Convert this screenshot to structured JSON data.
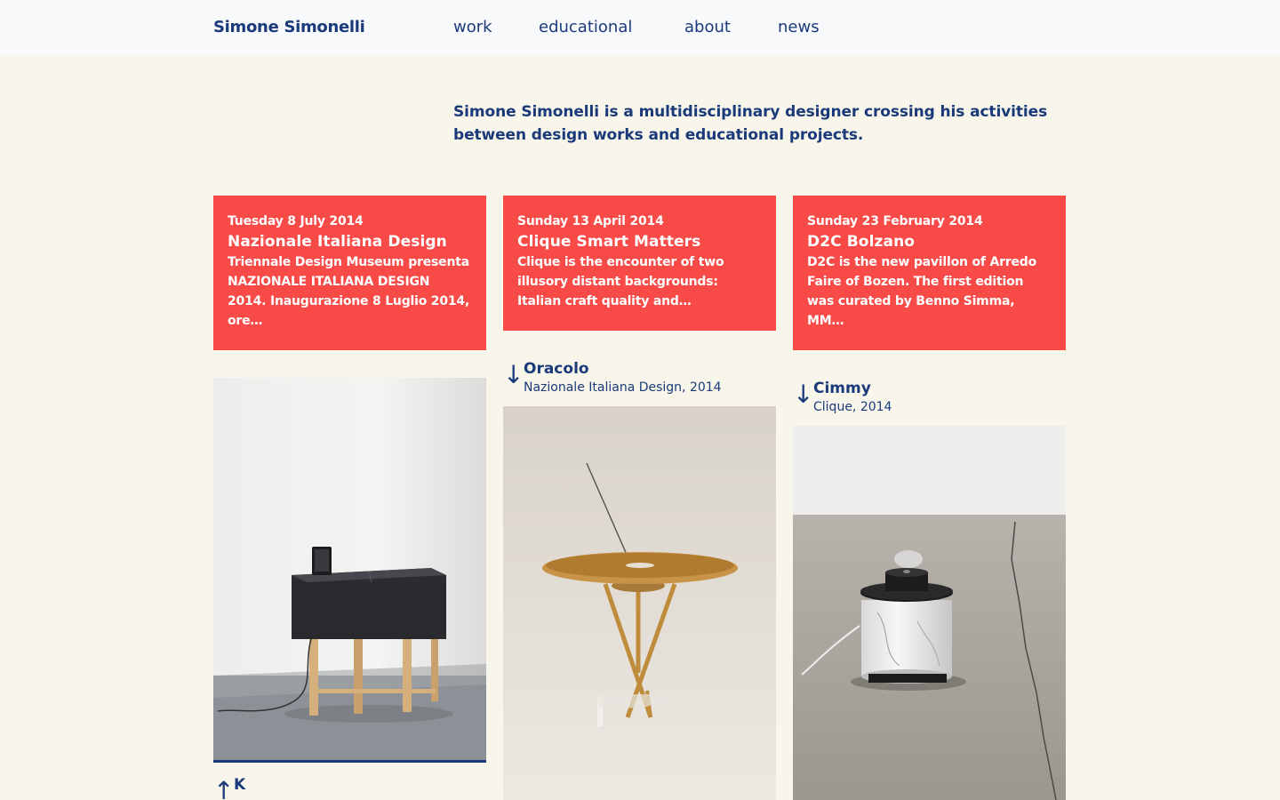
{
  "header": {
    "brand": "Simone Simonelli",
    "nav": [
      {
        "label": "work"
      },
      {
        "label": "educational"
      },
      {
        "label": "about"
      },
      {
        "label": "news"
      }
    ]
  },
  "intro": "Simone Simonelli is a multidisciplinary designer crossing his activities between design works and educational projects.",
  "news": [
    {
      "date": "Tuesday 8 July 2014",
      "title": "Nazionale Italiana Design",
      "excerpt": "Triennale Design Museum presenta NAZIONALE ITALIANA DESIGN 2014. Inaugurazione 8 Luglio 2014, ore…"
    },
    {
      "date": "Sunday 13 April 2014",
      "title": "Clique Smart Matters",
      "excerpt": "Clique is the encounter of two illusory distant backgrounds: Italian craft quality and…"
    },
    {
      "date": "Sunday 23 February 2014",
      "title": "D2C Bolzano",
      "excerpt": "D2C is the new pavillon of Arredo Faire of Bozen. The first edition was curated by Benno Simma, MM…"
    }
  ],
  "works": [
    {
      "name": "K",
      "arrow": "↑",
      "image": "desk-cabinet-photo"
    },
    {
      "name": "Oracolo",
      "subtitle": "Nazionale Italiana Design, 2014",
      "arrow": "↓",
      "image": "round-table-photo"
    },
    {
      "name": "Cimmy",
      "subtitle": "Clique, 2014",
      "arrow": "↓",
      "image": "marble-humidifier-photo"
    }
  ],
  "colors": {
    "background": "#f8f5ea",
    "header": "#f8f9fb",
    "accent": "#f84a47",
    "text": "#1a3a7a"
  }
}
